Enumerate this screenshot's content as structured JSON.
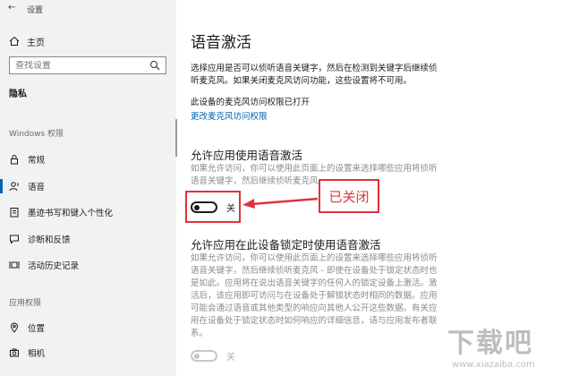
{
  "window": {
    "back_glyph": "←",
    "title": "设置"
  },
  "sidebar": {
    "home_label": "主页",
    "search": {
      "placeholder": "查找设置",
      "icon": "search-icon"
    },
    "privacy_heading": "隐私",
    "windows_permissions_label": "Windows 权限",
    "items": [
      {
        "label": "常规",
        "icon": "lock-icon"
      },
      {
        "label": "语音",
        "icon": "speech-icon",
        "active": true
      },
      {
        "label": "墨迹书写和键入个性化",
        "icon": "notepad-icon"
      },
      {
        "label": "诊断和反馈",
        "icon": "feedback-icon"
      },
      {
        "label": "活动历史记录",
        "icon": "timeline-icon"
      }
    ],
    "app_permissions_label": "应用权限",
    "app_items": [
      {
        "label": "位置",
        "icon": "location-icon"
      },
      {
        "label": "相机",
        "icon": "camera-icon"
      }
    ]
  },
  "main": {
    "title": "语音激活",
    "intro_line1": "选择应用是否可以侦听语音关键字，然后在检测到关键字后继续侦",
    "intro_line2": "听麦克风。如果关闭麦克风访问功能，这些设置将不可用。",
    "mic_status": "此设备的麦克风访问权限已打开",
    "change_link": "更改麦克风访问权限",
    "section1": {
      "title": "允许应用使用语音激活",
      "desc_line1": "如果允许访问，你可以使用此页面上的设置来选择哪些应用将侦听",
      "desc_line2": "语音关键字，然后继续侦听麦克风。",
      "toggle_state": "关"
    },
    "section2": {
      "title": "允许应用在此设备锁定时使用语音激活",
      "desc_lines": [
        "如果允许访问，你可以使用此页面上的设置来选择哪些应用将侦听",
        "语音关键字，然后继续侦听麦克风 - 即使在设备处于锁定状态时也",
        "是如此。应用将在说出语音关键字的任何人的锁定设备上激活。激",
        "活后，该应用即可访问与在设备处于解锁状态时相同的数据。应用",
        "可能会通过语音或其他类型的响应向其他人公开这些数据。有关应",
        "用在设备处于锁定状态时如何响应的详细信息，请与应用发布者联",
        "系。"
      ],
      "toggle_state": "关"
    }
  },
  "annotation": {
    "label": "已关闭",
    "color": "#e0323a"
  },
  "watermark": {
    "text": "下载吧",
    "url": "www.xiazaiba.com"
  },
  "colors": {
    "accent": "#0063b1",
    "sidebar_bg": "#f2f2f2"
  }
}
